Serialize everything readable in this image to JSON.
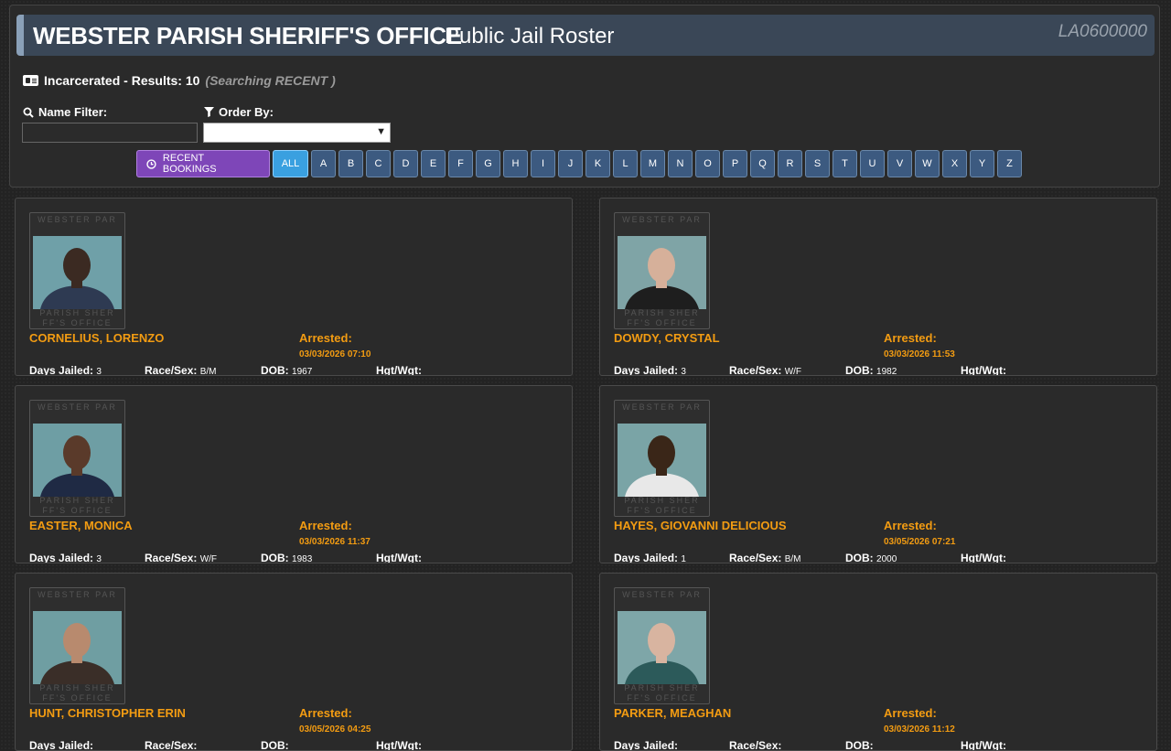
{
  "header": {
    "title": "WEBSTER PARISH SHERIFF'S OFFICE",
    "subtitle": "Public Jail Roster",
    "code": "LA0600000"
  },
  "results": {
    "label": "Incarcerated - Results: 10",
    "searching": "(Searching RECENT )"
  },
  "filters": {
    "name_label": "Name Filter:",
    "name_value": "",
    "order_label": "Order By:",
    "order_value": ""
  },
  "buttons": {
    "recent": "RECENT BOOKINGS",
    "all": "ALL",
    "letters": [
      "A",
      "B",
      "C",
      "D",
      "E",
      "F",
      "G",
      "H",
      "I",
      "J",
      "K",
      "L",
      "M",
      "N",
      "O",
      "P",
      "Q",
      "R",
      "S",
      "T",
      "U",
      "V",
      "W",
      "X",
      "Y",
      "Z"
    ]
  },
  "labels": {
    "arrested": "Arrested:",
    "days": "Days Jailed:",
    "race": "Race/Sex:",
    "dob": "DOB:",
    "hgt": "Hgt/Wgt:"
  },
  "watermark": {
    "line1": "WEBSTER PAR",
    "line2": "PARISH SHER",
    "line3": "FF'S OFFICE"
  },
  "inmates": [
    {
      "name": "CORNELIUS, LORENZO",
      "arrested": "03/03/2026 07:10",
      "days": "3",
      "race": "B/M",
      "dob": "1967",
      "hgt": "",
      "skin": "#3b2a22",
      "shirt": "#2e3a52",
      "bg": "#6fa0a8"
    },
    {
      "name": "DOWDY, CRYSTAL",
      "arrested": "03/03/2026 11:53",
      "days": "3",
      "race": "W/F",
      "dob": "1982",
      "hgt": "",
      "skin": "#d6b09a",
      "shirt": "#1e1e1e",
      "bg": "#7fa4a6"
    },
    {
      "name": "EASTER, MONICA",
      "arrested": "03/03/2026 11:37",
      "days": "3",
      "race": "W/F",
      "dob": "1983",
      "hgt": "",
      "skin": "#5a3a2a",
      "shirt": "#1f2a44",
      "bg": "#6e9ea4"
    },
    {
      "name": "HAYES, GIOVANNI DELICIOUS",
      "arrested": "03/05/2026 07:21",
      "days": "1",
      "race": "B/M",
      "dob": "2000",
      "hgt": "",
      "skin": "#3a2618",
      "shirt": "#e8e8e8",
      "bg": "#7aa4a6"
    },
    {
      "name": "HUNT, CHRISTOPHER ERIN",
      "arrested": "03/05/2026 04:25",
      "days": "",
      "race": "",
      "dob": "",
      "hgt": "",
      "skin": "#b88a6e",
      "shirt": "#3a2e28",
      "bg": "#6f9ea2"
    },
    {
      "name": "PARKER, MEAGHAN",
      "arrested": "03/03/2026 11:12",
      "days": "",
      "race": "",
      "dob": "",
      "hgt": "",
      "skin": "#d8b4a0",
      "shirt": "#2c5a5a",
      "bg": "#7ea6a8"
    }
  ]
}
